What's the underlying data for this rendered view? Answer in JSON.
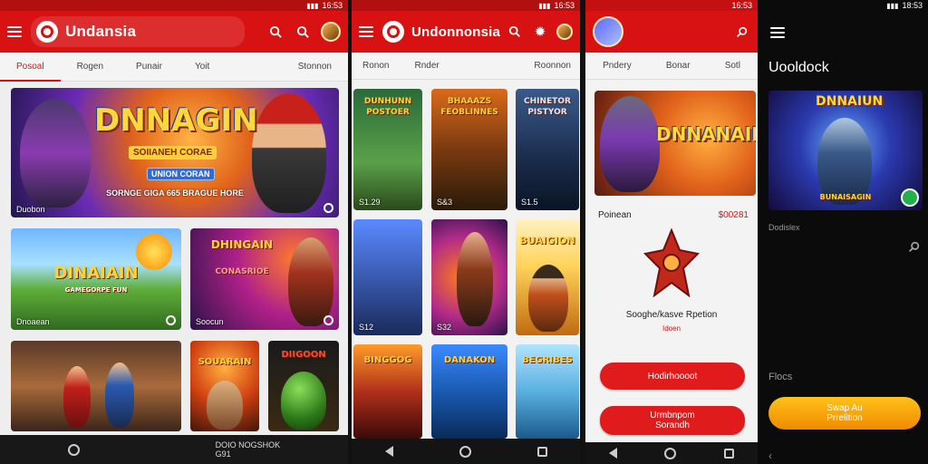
{
  "status": {
    "time1": "16:53",
    "time2": "16:53",
    "time3": "16:53",
    "time4": "18:53"
  },
  "screen1": {
    "app_title": "Undansia",
    "tabs": [
      "Posoal",
      "Rogen",
      "Punair",
      "Yoit",
      "Stonnon"
    ],
    "active_tab": 0,
    "hero": {
      "title": "DNNAGIN",
      "subtitle": "SOIIANEH CORAE",
      "badge": "UNION CORAN",
      "tagline": "SORNGE GIGA 665 BRAGUE HORE",
      "caption": "Duobon"
    },
    "cards": [
      {
        "title": "DINAIAIN",
        "subtitle": "GAMEGORPE FUN",
        "caption": "Dnoaean"
      },
      {
        "title": "DHINGAIN",
        "subtitle": "CONASRIOE",
        "caption": "Soocun"
      },
      {
        "title": "",
        "caption": ""
      },
      {
        "title": "SOUARAIN",
        "caption": ""
      },
      {
        "title": "DIIGOON",
        "caption": ""
      }
    ],
    "bottom_text": [
      "DOIO NOGSHOK",
      "G91"
    ]
  },
  "screen2": {
    "app_title": "Undonnonsia",
    "tabs": [
      "Ronon",
      "Rnder",
      "Roonnon"
    ],
    "posters": [
      {
        "title": "DUNHUNN POSTOER",
        "price": "S1.29"
      },
      {
        "title": "BHAAAZS FEOBLINNES",
        "price": "S&3"
      },
      {
        "title": "CHINETOR PISTYOR",
        "price": "S1.5"
      },
      {
        "title": "",
        "price": "S12"
      },
      {
        "title": "",
        "price": "S32"
      },
      {
        "title": "BUAIGION",
        "price": ""
      },
      {
        "title": "BINGGOG",
        "price": ""
      },
      {
        "title": "DANAKON",
        "price": ""
      },
      {
        "title": "BEGRIBES",
        "price": ""
      }
    ]
  },
  "screen3": {
    "tabs": [
      "Pndery",
      "Bonar",
      "Sotl"
    ],
    "hero_title": "DNNANAIN",
    "section_label": "Poinean",
    "section_value": "$00281",
    "item_title": "Sooghe/kasve Rpetion",
    "item_sub": "Idoen",
    "buttons": [
      "Hodirhoooot",
      "Urmbnpom Sorandh"
    ]
  },
  "screen4": {
    "title": "Uooldock",
    "hero_title": "DNNAIUN",
    "hero_sub": "BUNAISAGIN",
    "label1": "Dodislex",
    "label2": "Flocs",
    "button": "Swap Au Prrelition"
  },
  "colors": {
    "brand_red": "#d81212",
    "accent_orange": "#f5a300",
    "dark_bg": "#0b0b0b"
  }
}
